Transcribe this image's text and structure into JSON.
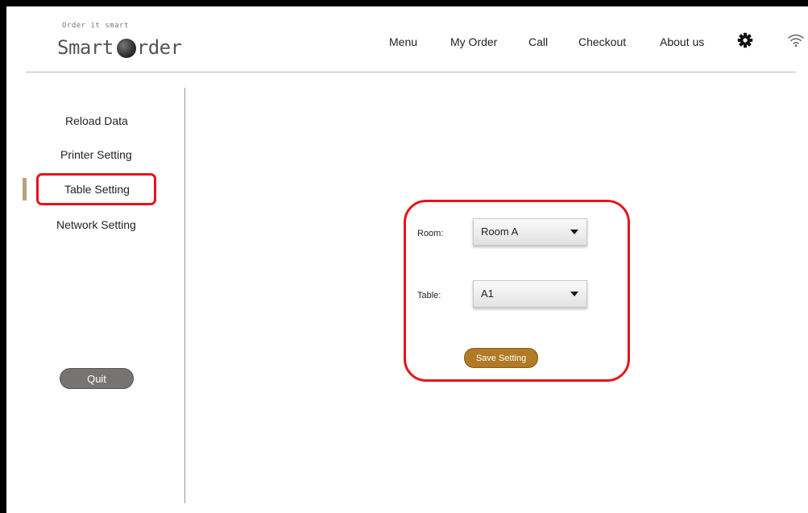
{
  "app": {
    "logo_tagline": "Order it smart",
    "logo_text_before": "Smart",
    "logo_text_after": "rder"
  },
  "nav": {
    "items": [
      {
        "label": "Menu"
      },
      {
        "label": "My Order"
      },
      {
        "label": "Call"
      },
      {
        "label": "Checkout"
      },
      {
        "label": "About us"
      }
    ],
    "settings_icon": "gear-icon",
    "wifi_icon": "wifi-icon"
  },
  "sidebar": {
    "items": [
      {
        "label": "Reload Data"
      },
      {
        "label": "Printer Setting"
      },
      {
        "label": "Table Setting",
        "active": true
      },
      {
        "label": "Network Setting"
      }
    ],
    "quit_label": "Quit"
  },
  "form": {
    "room_label": "Room:",
    "room_value": "Room A",
    "table_label": "Table:",
    "table_value": "A1",
    "save_label": "Save Setting"
  },
  "colors": {
    "highlight": "#e8141a",
    "active_marker": "#b9a27c",
    "save_button": "#b07a27",
    "quit_button": "#767472"
  }
}
